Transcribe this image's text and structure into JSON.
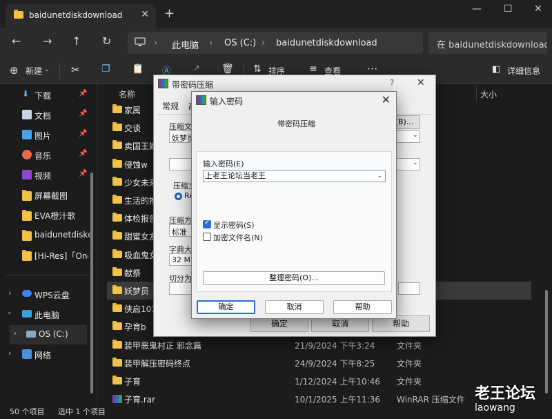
{
  "window": {
    "tab_title": "baidunetdiskdownload",
    "new_tab": "+",
    "tab_close": "✕",
    "minimize": "—",
    "maximize": "☐",
    "close": "✕"
  },
  "address": {
    "crumbs": [
      "此电脑",
      "OS (C:)",
      "baidunetdiskdownload"
    ],
    "separator": "›",
    "search_placeholder": "在 baidunetdiskdownload 中搜索"
  },
  "toolbar": {
    "new": "新建",
    "sort": "排序",
    "view": "查看",
    "more": "···",
    "details": "详细信息"
  },
  "nav": {
    "quick": [
      {
        "label": "下载",
        "icon": "download-icon"
      },
      {
        "label": "文档",
        "icon": "document-icon"
      },
      {
        "label": "图片",
        "icon": "picture-icon"
      },
      {
        "label": "音乐",
        "icon": "music-icon"
      },
      {
        "label": "视频",
        "icon": "video-icon"
      },
      {
        "label": "屏幕截图",
        "icon": "folder-icon"
      },
      {
        "label": "EVA橙汁歌",
        "icon": "folder-icon"
      },
      {
        "label": "baidunetdiskd",
        "icon": "folder-icon"
      },
      {
        "label": "[Hi-Res]「One",
        "icon": "folder-icon"
      }
    ],
    "tree": [
      {
        "label": "WPS云盘",
        "icon": "cloud-icon"
      },
      {
        "label": "此电脑",
        "icon": "computer-icon"
      },
      {
        "label": "OS (C:)",
        "icon": "drive-icon"
      },
      {
        "label": "网络",
        "icon": "network-icon"
      }
    ]
  },
  "columns": {
    "name": "名称",
    "size": "大小"
  },
  "files": [
    {
      "name": "家属",
      "date": "",
      "type": ""
    },
    {
      "name": "交谈",
      "date": "",
      "type": ""
    },
    {
      "name": "卖国王姬",
      "date": "",
      "type": ""
    },
    {
      "name": "侵蚀w",
      "date": "",
      "type": ""
    },
    {
      "name": "少女未来",
      "date": "",
      "type": ""
    },
    {
      "name": "生活的推",
      "date": "",
      "type": ""
    },
    {
      "name": "体检报告",
      "date": "",
      "type": ""
    },
    {
      "name": "甜蜜女友",
      "date": "",
      "type": ""
    },
    {
      "name": "吸血鬼女",
      "date": "",
      "type": ""
    },
    {
      "name": "献祭",
      "date": "",
      "type": ""
    },
    {
      "name": "妖梦员",
      "date": "",
      "type": ""
    },
    {
      "name": "侠启101",
      "date": "",
      "type": ""
    },
    {
      "name": "孕育b",
      "date": "",
      "type": ""
    },
    {
      "name": "装甲恶鬼村正 邪念篇",
      "date": "21/9/2024 下午3:24",
      "type": "文件夹"
    },
    {
      "name": "装甲解压密码终点",
      "date": "24/9/2024 下午8:25",
      "type": "文件夹"
    },
    {
      "name": "子育",
      "date": "1/12/2024 上午10:46",
      "type": "文件夹"
    },
    {
      "name": "子育.rar",
      "date": "10/1/2025 上午11:36",
      "type": "WinRAR 压缩文件"
    }
  ],
  "status": {
    "count": "50 个项目",
    "selected": "选中 1 个项目"
  },
  "dialog_back": {
    "title": "带密码压缩",
    "help": "?",
    "close": "✕",
    "tab_general": "常规",
    "tab_advanced": "高",
    "archive_label": "压缩文",
    "archive_value": "妖梦员",
    "browse": "(B)...",
    "format_label": "压缩文",
    "format_radio": "RA",
    "method_label": "压缩方",
    "method_value": "标准",
    "dict_label": "字典大小",
    "dict_value": "32 MB",
    "split_label": "切分为分",
    "ok": "确定",
    "cancel": "取消",
    "help_btn": "帮助"
  },
  "dialog_pwd": {
    "title": "输入密码",
    "close": "✕",
    "subtitle": "带密码压缩",
    "enter_label": "输入密码(E)",
    "password": "上老王论坛当老王",
    "show_password": "显示密码(S)",
    "show_password_checked": true,
    "encrypt_names": "加密文件名(N)",
    "encrypt_names_checked": false,
    "organize": "整理密码(O)...",
    "ok": "确定",
    "cancel": "取消",
    "help": "帮助"
  },
  "watermark": {
    "cn": "老王论坛",
    "en": "laowang"
  }
}
